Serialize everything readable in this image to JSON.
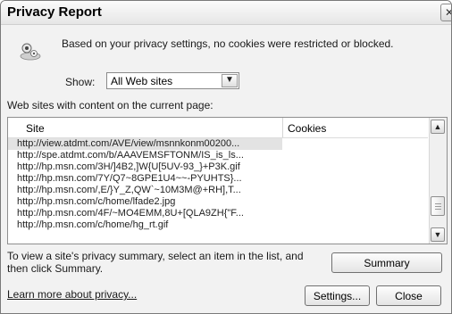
{
  "window": {
    "title": "Privacy Report",
    "close_glyph": "✕"
  },
  "summary": {
    "icon": "privacy-report-icon",
    "text": "Based on your privacy settings, no cookies were restricted or blocked."
  },
  "filter": {
    "label": "Show:",
    "selected": "All Web sites"
  },
  "sites": {
    "label": "Web sites with content on the current page:",
    "columns": [
      "Site",
      "Cookies"
    ],
    "rows": [
      {
        "site": "http://view.atdmt.com/AVE/view/msnnkonm00200...",
        "cookies": "",
        "selected": true
      },
      {
        "site": "http://spe.atdmt.com/b/AAAVEMSFTONM/IS_is_ls...",
        "cookies": ""
      },
      {
        "site": "http://hp.msn.com/3H/]4B2,]W{U[5UV-93_}+P3K.gif",
        "cookies": ""
      },
      {
        "site": "http://hp.msn.com/7Y/Q7~8GPE1U4~~-PYUHTS}...",
        "cookies": ""
      },
      {
        "site": "http://hp.msn.com/,E/}Y_Z,QW`~10M3M@+RH],T...",
        "cookies": ""
      },
      {
        "site": "http://hp.msn.com/c/home/lfade2.jpg",
        "cookies": ""
      },
      {
        "site": "http://hp.msn.com/4F/~MO4EMM,8U+[QLA9ZH{\"F...",
        "cookies": ""
      },
      {
        "site": "http://hp.msn.com/c/home/hg_rt.gif",
        "cookies": ""
      }
    ]
  },
  "hint": "To view a site's privacy summary, select an item in the list, and then click Summary.",
  "buttons": {
    "summary": "Summary",
    "settings": "Settings...",
    "close": "Close"
  },
  "learn_more": "Learn more about privacy..."
}
